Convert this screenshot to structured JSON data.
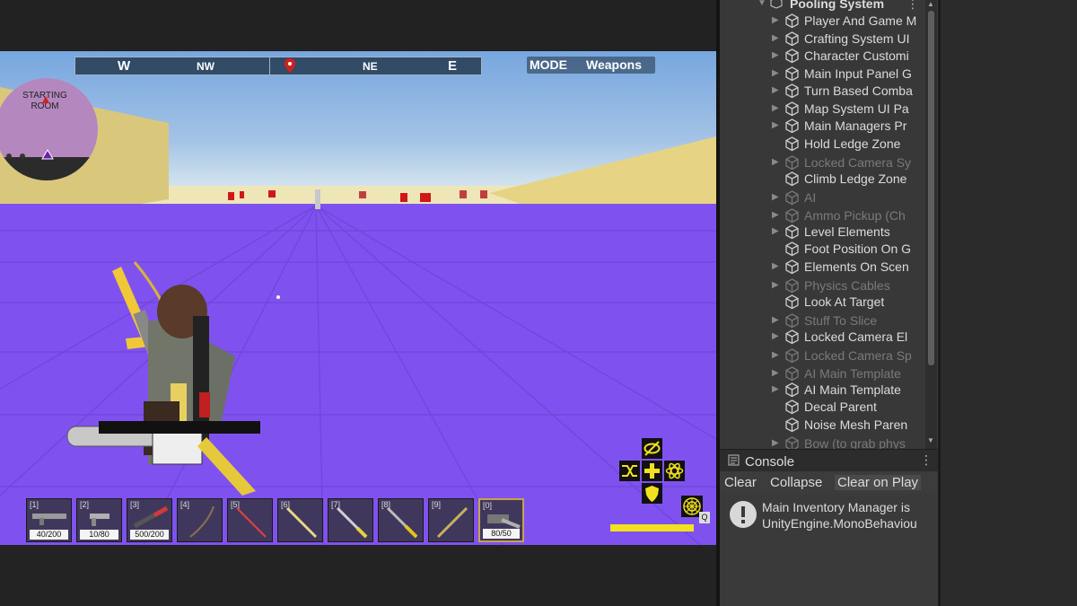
{
  "game": {
    "compass": {
      "w": "W",
      "nw": "NW",
      "ne": "NE",
      "e": "E"
    },
    "mode": {
      "label": "MODE",
      "value": "Weapons"
    },
    "minimap": {
      "line1": "STARTING",
      "line2": "ROOM"
    },
    "hotbar": [
      {
        "num": "[1]",
        "ammo": "40/200",
        "color": "#9a9a9a"
      },
      {
        "num": "[2]",
        "ammo": "10/80",
        "color": "#b0b0b0"
      },
      {
        "num": "[3]",
        "ammo": "500/200",
        "color": "#d03a3a"
      },
      {
        "num": "[4]",
        "ammo": "",
        "color": "#8a7050"
      },
      {
        "num": "[5]",
        "ammo": "",
        "color": "#e04040"
      },
      {
        "num": "[6]",
        "ammo": "",
        "color": "#e6d88a"
      },
      {
        "num": "[7]",
        "ammo": "",
        "color": "#e8d040"
      },
      {
        "num": "[8]",
        "ammo": "",
        "color": "#e8c020"
      },
      {
        "num": "[9]",
        "ammo": "",
        "color": "#c8b060"
      },
      {
        "num": "[0]",
        "ammo": "80/50",
        "color": "#b0b0b0"
      }
    ],
    "q_key": "Q"
  },
  "hierarchy": {
    "items": [
      {
        "label": "Pooling System",
        "dim": false,
        "arrow": "▼"
      },
      {
        "label": "Player And Game M",
        "dim": false,
        "arrow": "▶"
      },
      {
        "label": "Crafting System UI",
        "dim": false,
        "arrow": "▶"
      },
      {
        "label": "Character Customi",
        "dim": false,
        "arrow": "▶"
      },
      {
        "label": "Main Input Panel G",
        "dim": false,
        "arrow": "▶"
      },
      {
        "label": "Turn Based Comba",
        "dim": false,
        "arrow": "▶"
      },
      {
        "label": "Map System UI Pa",
        "dim": false,
        "arrow": "▶"
      },
      {
        "label": "Main Managers Pr",
        "dim": false,
        "arrow": "▶"
      },
      {
        "label": "Hold Ledge Zone",
        "dim": false,
        "arrow": ""
      },
      {
        "label": "Locked Camera Sy",
        "dim": true,
        "arrow": "▶"
      },
      {
        "label": "Climb Ledge Zone",
        "dim": false,
        "arrow": ""
      },
      {
        "label": "AI",
        "dim": true,
        "arrow": "▶"
      },
      {
        "label": "Ammo Pickup (Ch",
        "dim": true,
        "arrow": "▶"
      },
      {
        "label": "Level Elements",
        "dim": false,
        "arrow": "▶"
      },
      {
        "label": "Foot Position On G",
        "dim": false,
        "arrow": ""
      },
      {
        "label": "Elements On Scen",
        "dim": false,
        "arrow": "▶"
      },
      {
        "label": "Physics Cables",
        "dim": true,
        "arrow": "▶"
      },
      {
        "label": "Look At Target",
        "dim": false,
        "arrow": ""
      },
      {
        "label": "Stuff To Slice",
        "dim": true,
        "arrow": "▶"
      },
      {
        "label": "Locked Camera El",
        "dim": false,
        "arrow": "▶"
      },
      {
        "label": "Locked Camera Sp",
        "dim": true,
        "arrow": "▶"
      },
      {
        "label": "AI Main Template",
        "dim": true,
        "arrow": "▶"
      },
      {
        "label": "AI Main Template",
        "dim": false,
        "arrow": "▶"
      },
      {
        "label": "Decal Parent",
        "dim": false,
        "arrow": ""
      },
      {
        "label": "Noise Mesh Paren",
        "dim": false,
        "arrow": ""
      },
      {
        "label": "Bow (to grab phys",
        "dim": true,
        "arrow": "▶"
      }
    ]
  },
  "console": {
    "title": "Console",
    "buttons": {
      "clear": "Clear",
      "collapse": "Collapse",
      "clear_on_play": "Clear on Play"
    },
    "message": {
      "line1": "Main Inventory Manager is",
      "line2": "UnityEngine.MonoBehaviou"
    }
  },
  "colors": {
    "floor": "#8052f0",
    "sand": "#e8d88a",
    "accent": "#f2e11e"
  }
}
